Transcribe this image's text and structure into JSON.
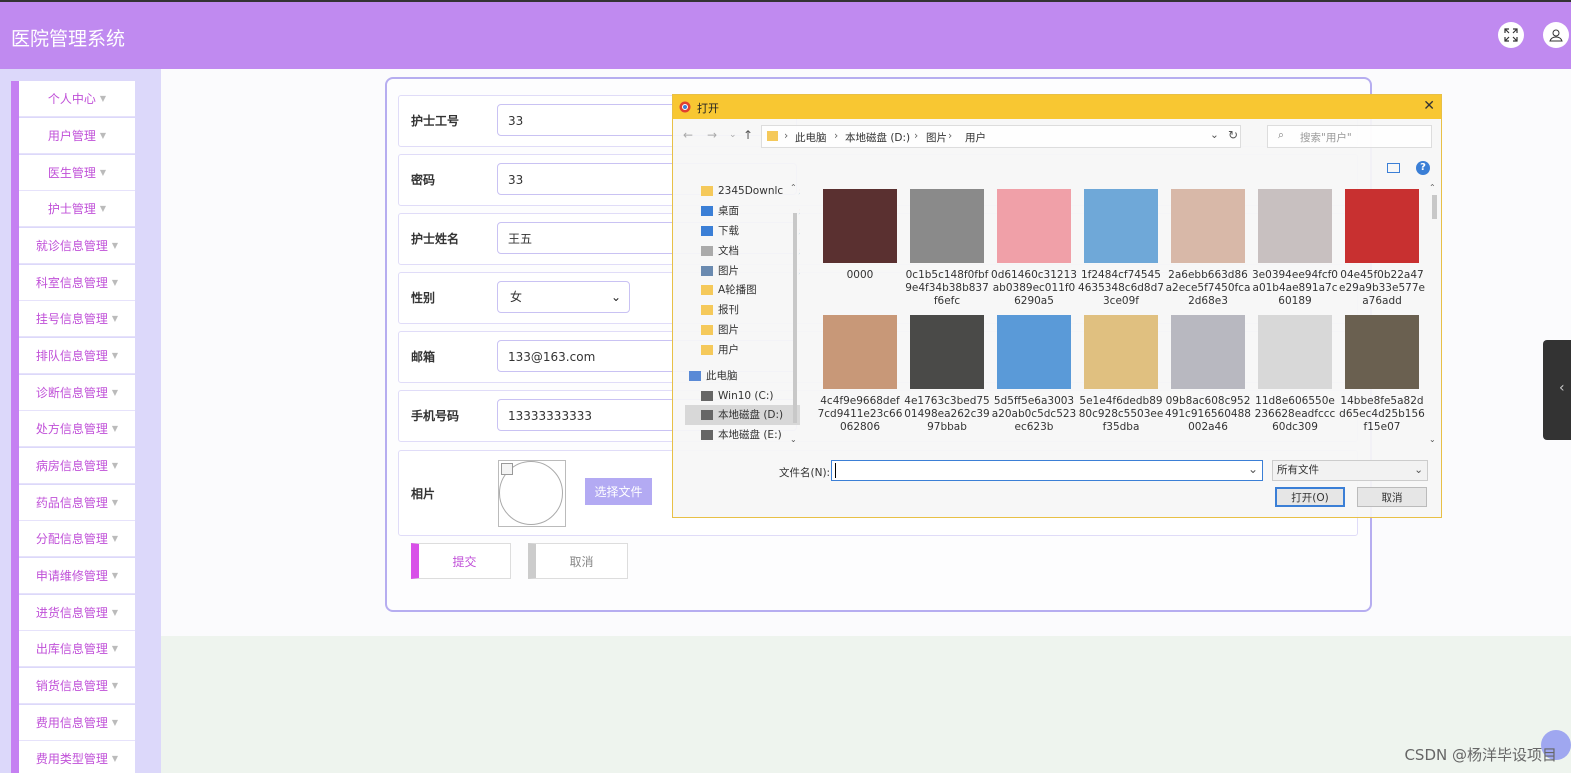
{
  "header": {
    "title": "医院管理系统"
  },
  "sidebar": {
    "items": [
      {
        "label": "个人中心"
      },
      {
        "label": "用户管理"
      },
      {
        "label": "医生管理"
      },
      {
        "label": "护士管理"
      },
      {
        "label": "就诊信息管理"
      },
      {
        "label": "科室信息管理"
      },
      {
        "label": "挂号信息管理"
      },
      {
        "label": "排队信息管理"
      },
      {
        "label": "诊断信息管理"
      },
      {
        "label": "处方信息管理"
      },
      {
        "label": "病房信息管理"
      },
      {
        "label": "药品信息管理"
      },
      {
        "label": "分配信息管理"
      },
      {
        "label": "申请维修管理"
      },
      {
        "label": "进货信息管理"
      },
      {
        "label": "出库信息管理"
      },
      {
        "label": "销货信息管理"
      },
      {
        "label": "费用信息管理"
      },
      {
        "label": "费用类型管理"
      }
    ]
  },
  "form": {
    "nurse_id_label": "护士工号",
    "nurse_id_value": "33",
    "password_label": "密码",
    "password_value": "33",
    "name_label": "护士姓名",
    "name_value": "王五",
    "gender_label": "性别",
    "gender_value": "女",
    "email_label": "邮箱",
    "email_value": "133@163.com",
    "phone_label": "手机号码",
    "phone_value": "13333333333",
    "photo_label": "相片",
    "choose_file_label": "选择文件",
    "submit_label": "提交",
    "cancel_label": "取消"
  },
  "dialog": {
    "title": "打开",
    "breadcrumb": [
      "此电脑",
      "本地磁盘 (D:)",
      "图片",
      "用户"
    ],
    "search_placeholder": "搜索\"用户\"",
    "tree": [
      {
        "label": "2345Downlc",
        "icon": "folder-icon",
        "pinned": true
      },
      {
        "label": "桌面",
        "icon": "desktop-icon",
        "pinned": true
      },
      {
        "label": "下载",
        "icon": "download-icon",
        "pinned": true
      },
      {
        "label": "文档",
        "icon": "document-icon",
        "pinned": true
      },
      {
        "label": "图片",
        "icon": "pictures-icon",
        "pinned": true
      },
      {
        "label": "A轮播图",
        "icon": "folder-icon",
        "pinned": false
      },
      {
        "label": "报刊",
        "icon": "folder-icon",
        "pinned": false
      },
      {
        "label": "图片",
        "icon": "folder-icon",
        "pinned": false
      },
      {
        "label": "用户",
        "icon": "folder-icon",
        "pinned": false
      },
      {
        "label": "此电脑",
        "icon": "computer-icon",
        "pinned": false
      },
      {
        "label": "Win10 (C:)",
        "icon": "drive-icon",
        "pinned": false
      },
      {
        "label": "本地磁盘 (D:)",
        "icon": "drive-icon",
        "pinned": false,
        "selected": true
      },
      {
        "label": "本地磁盘 (E:)",
        "icon": "drive-icon",
        "pinned": false
      }
    ],
    "files": [
      {
        "name": "0000",
        "color": "#5a3030"
      },
      {
        "name": "0c1b5c148f0fbf9e4f34b38b837f6efc",
        "color": "#8a8a8a"
      },
      {
        "name": "0d61460c31213ab0389ec011f06290a5",
        "color": "#f0a0a8"
      },
      {
        "name": "1f2484cf745454635348c6d8d73ce09f",
        "color": "#6fa8d8"
      },
      {
        "name": "2a6ebb663d86a2ece5f7450fca2d68e3",
        "color": "#d8b8a8"
      },
      {
        "name": "3e0394ee94fcf0a01b4ae891a7c60189",
        "color": "#c8c0c0"
      },
      {
        "name": "04e45f0b22a47e29a9b33e577ea76add",
        "color": "#c83030"
      },
      {
        "name": "4c4f9e9668def7cd9411e23c66062806",
        "color": "#c89878"
      },
      {
        "name": "4e1763c3bed7501498ea262c3997bbab",
        "color": "#4a4a48"
      },
      {
        "name": "5d5ff5e6a3003a20ab0c5dc523ec623b",
        "color": "#5a9ad8"
      },
      {
        "name": "5e1e4f6dedb8980c928c5503eef35dba",
        "color": "#e0c080"
      },
      {
        "name": "09b8ac608c952491c916560488002a46",
        "color": "#b8b8c0"
      },
      {
        "name": "11d8e606550e236628eadfccc60dc309",
        "color": "#d8d8d8"
      },
      {
        "name": "14bbe8fe5a82dd65ec4d25b156f15e07",
        "color": "#6a6050"
      }
    ],
    "filename_label": "文件名(N):",
    "filename_value": "",
    "filetype_value": "所有文件",
    "open_label": "打开(O)",
    "cancel_label": "取消"
  },
  "watermark": "CSDN @杨洋毕设项目"
}
